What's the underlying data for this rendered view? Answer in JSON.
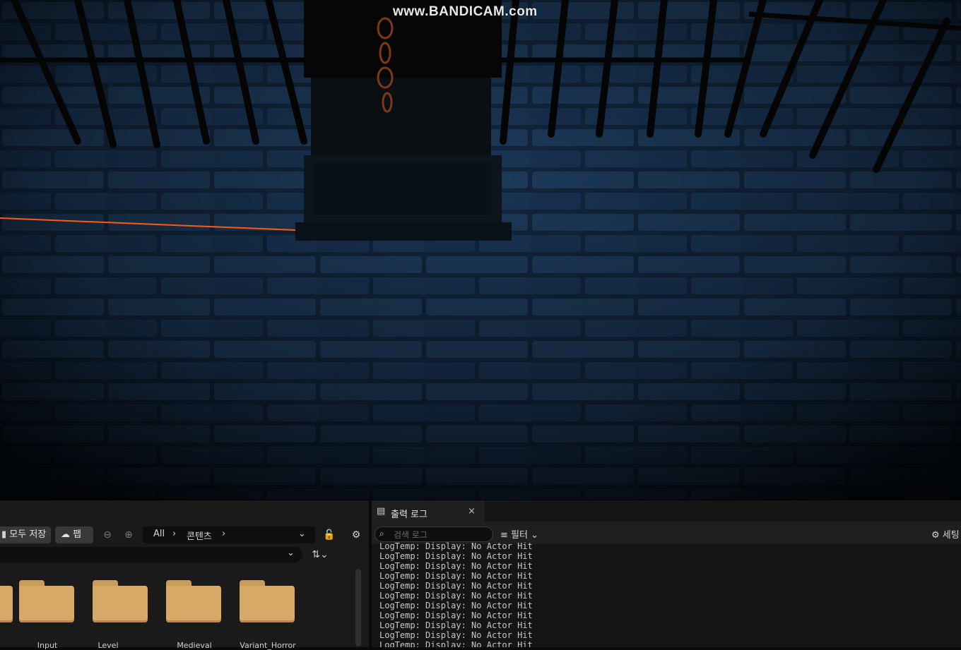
{
  "watermark": "www.BANDICAM.com",
  "content_browser": {
    "save_all_label": "모두 저장",
    "fab_label": "팹",
    "breadcrumb": [
      "All",
      "콘텐츠"
    ],
    "folders": [
      {
        "label": "Input"
      },
      {
        "label": "Level"
      },
      {
        "label": "Medieval"
      },
      {
        "label": "Variant_Horror"
      }
    ]
  },
  "output_log": {
    "tab_label": "출력 로그",
    "close_label": "×",
    "search_placeholder": "검색 로그",
    "filter_label": "필터",
    "settings_label": "세팅",
    "lines": [
      "LogTemp: Display: No Actor Hit",
      "LogTemp: Display: No Actor Hit",
      "LogTemp: Display: No Actor Hit",
      "LogTemp: Display: No Actor Hit",
      "LogTemp: Display: No Actor Hit",
      "LogTemp: Display: No Actor Hit",
      "LogTemp: Display: No Actor Hit",
      "LogTemp: Display: No Actor Hit",
      "LogTemp: Display: No Actor Hit",
      "LogTemp: Display: No Actor Hit",
      "LogTemp: Display: No Actor Hit"
    ]
  }
}
